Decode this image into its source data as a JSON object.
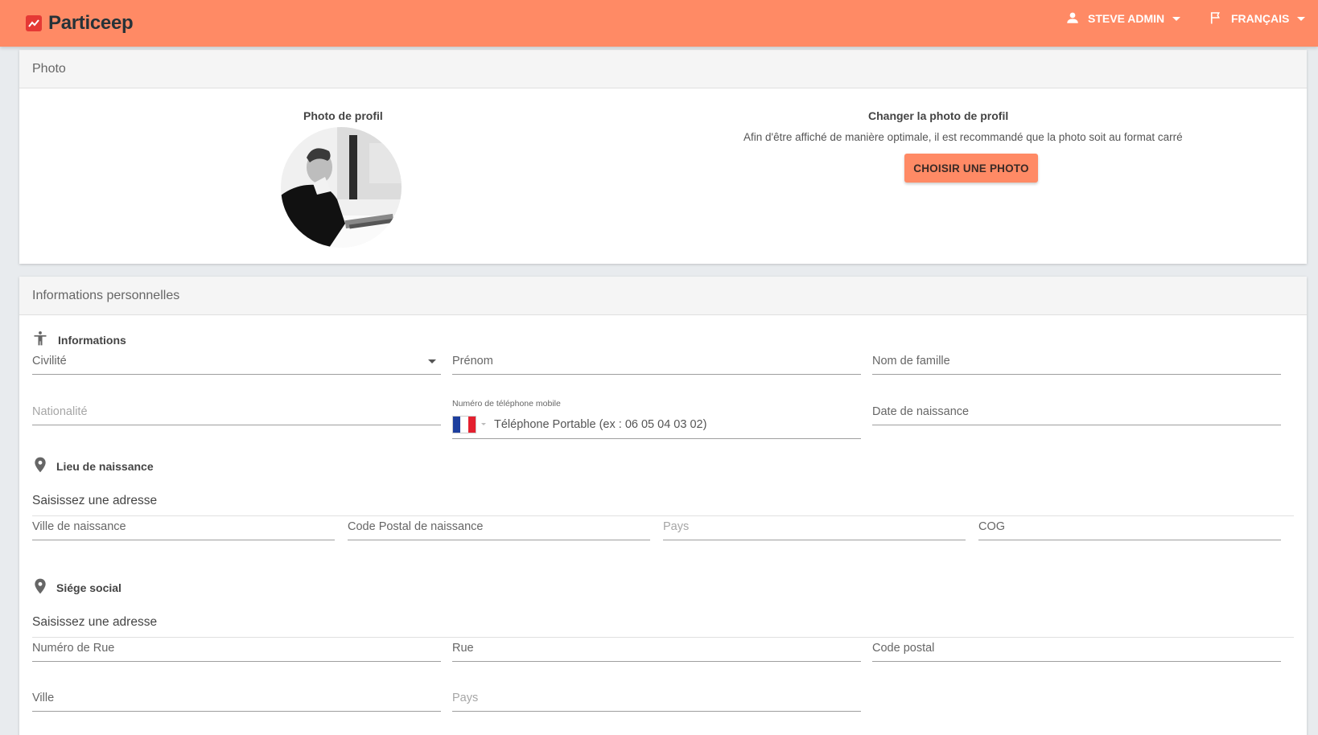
{
  "header": {
    "brand": "Particeep",
    "user": "STEVE ADMIN",
    "language": "FRANÇAIS",
    "bg_color": "#ff8a65"
  },
  "photo_section": {
    "title": "Photo",
    "profile_label": "Photo de profil",
    "change_title": "Changer la photo de profil",
    "change_hint": "Afin d'être affiché de manière optimale, il est recommandé que la photo soit au format carré",
    "choose_button": "CHOISIR UNE PHOTO"
  },
  "personal_section": {
    "title": "Informations personnelles",
    "informations_heading": "Informations",
    "civilite": "Civilité",
    "prenom": "Prénom",
    "nom_famille": "Nom de famille",
    "nationalite": "Nationalité",
    "phone_label": "Numéro de téléphone mobile",
    "phone_placeholder": "Téléphone Portable (ex : 06 05 04 03 02)",
    "date_naissance": "Date de naissance",
    "birthplace_heading": "Lieu de naissance",
    "birthplace_address": "Saisissez une adresse",
    "ville_naissance": "Ville de naissance",
    "code_postal_naissance": "Code Postal de naissance",
    "pays_naissance": "Pays",
    "cog": "COG",
    "siege_heading": "Siége social",
    "siege_address": "Saisissez une adresse",
    "numero_rue": "Numéro de Rue",
    "rue": "Rue",
    "code_postal": "Code postal",
    "ville": "Ville",
    "pays": "Pays"
  },
  "icons": {
    "logo": "chart-icon",
    "user": "person-icon",
    "flag": "flag-icon",
    "informations": "accessibility-icon",
    "place": "map-pin-icon"
  }
}
